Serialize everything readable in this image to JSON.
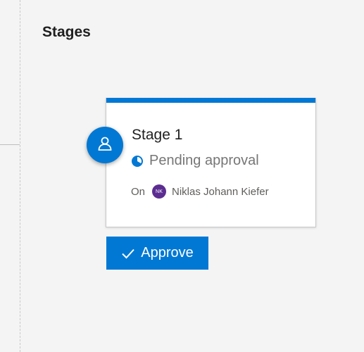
{
  "page": {
    "title": "Stages"
  },
  "stage": {
    "name": "Stage 1",
    "status": "Pending approval",
    "on_label": "On",
    "approver": {
      "initials": "NK",
      "name": "Niklas Johann Kiefer"
    },
    "icons": {
      "stage": "user-icon",
      "status": "clock-icon"
    }
  },
  "actions": {
    "approve_label": "Approve",
    "approve_icon": "checkmark-icon"
  },
  "colors": {
    "accent": "#0078d4",
    "avatar": "#5c2d91"
  }
}
